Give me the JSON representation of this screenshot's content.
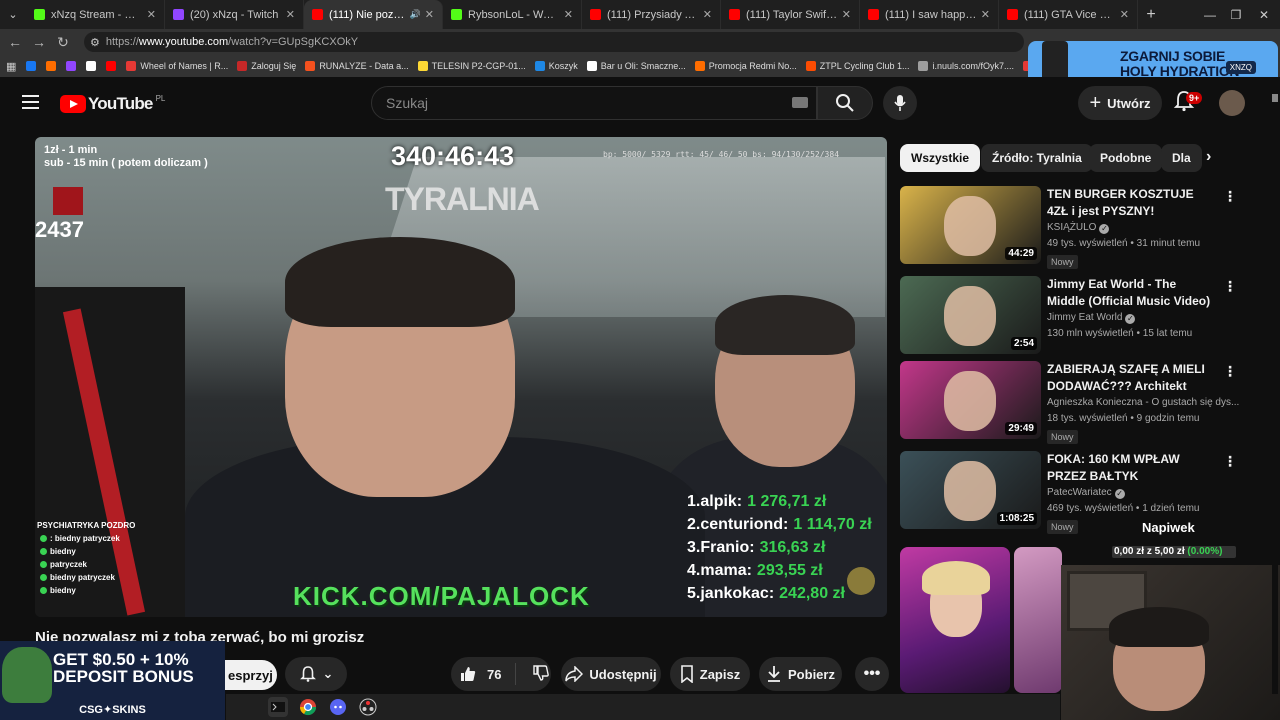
{
  "browser": {
    "tabs": [
      {
        "title": "xNzq Stream - Watch Live",
        "color": "#53fc18",
        "active": false
      },
      {
        "title": "(20) xNzq - Twitch",
        "color": "#9146ff",
        "active": false
      },
      {
        "title": "(111) Nie pozwalasz m",
        "color": "#ff0000",
        "active": true
      },
      {
        "title": "RybsonLoL - Watch clips",
        "color": "#53fc18",
        "active": false
      },
      {
        "title": "(111) Przysiady ATG 100 k",
        "color": "#ff0000",
        "active": false
      },
      {
        "title": "(111) Taylor Swift - Shake",
        "color": "#ff0000",
        "active": false
      },
      {
        "title": "(111) I saw happiness and",
        "color": "#ff0000",
        "active": false
      },
      {
        "title": "(111) GTA Vice City Radio",
        "color": "#ff0000",
        "active": false
      }
    ],
    "url_prefix": "https://",
    "url_host": "www.youtube.com",
    "url_path": "/watch?v=GUpSgKCXOkY",
    "bookmarks": [
      {
        "label": "",
        "color": "#1877f2"
      },
      {
        "label": "",
        "color": "#ff6d00"
      },
      {
        "label": "",
        "color": "#9146ff"
      },
      {
        "label": "",
        "color": "#ffffff"
      },
      {
        "label": "",
        "color": "#ff0000"
      },
      {
        "label": "Wheel of Names | R...",
        "color": "#e53935"
      },
      {
        "label": "Zaloguj Się",
        "color": "#c62828"
      },
      {
        "label": "RUNALYZE - Data a...",
        "color": "#f4511e"
      },
      {
        "label": "TELESIN P2-CGP-01...",
        "color": "#fdd835"
      },
      {
        "label": "Koszyk",
        "color": "#1e88e5"
      },
      {
        "label": "Bar u Oli: Smaczne...",
        "color": "#ffffff"
      },
      {
        "label": "Promocja Redmi No...",
        "color": "#ff6d00"
      },
      {
        "label": "ZTPL Cycling Club 1...",
        "color": "#fc4c02"
      },
      {
        "label": "i.nuuls.com/fOyk7....",
        "color": "#9e9e9e"
      },
      {
        "label": "Login",
        "color": "#e53935"
      }
    ]
  },
  "ads": {
    "top_headline_1": "ZGARNIJ SOBIE",
    "top_headline_2": "HOLY HYDRATION",
    "top_badge": "XNZQ",
    "bottom_line_1": "GET $0.50 + 10%",
    "bottom_line_2": "DEPOSIT BONUS",
    "bottom_brand": "CSG✦SKINS"
  },
  "yt": {
    "logo_text": "YouTube",
    "logo_region": "PL",
    "search_placeholder": "Szukaj",
    "create_label": "Utwórz",
    "notif_count": "9+"
  },
  "video": {
    "overlay_prices_1": "1zł - 1 min",
    "overlay_prices_2": "sub - 15 min ( potem doliczam )",
    "overlay_timer": "340:46:43",
    "overlay_stats": "bp: 5000/ 5329 rtt: 45/ 46/ 50 bs: 94/130/252/384",
    "overlay_logo": "TYRALNIA",
    "overlay_count": "2437",
    "leaderboard": [
      {
        "rank": "1.",
        "name": "alpik:",
        "amount": "1 276,71 zł"
      },
      {
        "rank": "2.",
        "name": "centuriond:",
        "amount": "1 114,70 zł"
      },
      {
        "rank": "3.",
        "name": "Franio:",
        "amount": "316,63 zł"
      },
      {
        "rank": "4.",
        "name": "mama:",
        "amount": "293,55 zł"
      },
      {
        "rank": "5.",
        "name": "jankokac:",
        "amount": "242,80 zł"
      }
    ],
    "kick_text": "KICK.COM/PAJALOCK",
    "chat_header": "PSYCHIATRYKA POZDRO",
    "chat_lines": [
      ": biedny patryczek",
      "biedny",
      "patryczek",
      "biedny patryczek",
      "biedny"
    ],
    "title": "Nie pozwalasz mi z tobą zerwać, bo mi grozisz"
  },
  "actions": {
    "join_partial": "esprzyj",
    "like_count": "76",
    "share": "Udostępnij",
    "save": "Zapisz",
    "download": "Pobierz"
  },
  "chips": [
    "Wszystkie",
    "Źródło: Tyralnia",
    "Podobne",
    "Dla"
  ],
  "related": [
    {
      "title": "TEN BURGER KOSZTUJE 4ZŁ i jest PYSZNY!",
      "channel": "KSIĄŻULO",
      "verified": true,
      "meta": "49 tys. wyświetleń • 31 minut temu",
      "duration": "44:29",
      "new": "Nowy",
      "thumb": "#d9b34a"
    },
    {
      "title": "Jimmy Eat World - The Middle (Official Music Video)",
      "channel": "Jimmy Eat World",
      "verified": true,
      "meta": "130 mln wyświetleń • 15 lat temu",
      "duration": "2:54",
      "new": "",
      "thumb": "#4c6a53"
    },
    {
      "title": "ZABIERAJĄ SZAFĘ A MIELI DODAWAĆ??? Architekt wnętr...",
      "channel": "Agnieszka Konieczna - O gustach się dys...",
      "verified": false,
      "meta": "18 tys. wyświetleń • 9 godzin temu",
      "duration": "29:49",
      "new": "Nowy",
      "thumb": "#c2378a"
    },
    {
      "title": "FOKA: 160 KM WPŁAW PRZEZ BAŁTYK",
      "channel": "PatecWariatec",
      "verified": true,
      "meta": "469 tys. wyświetleń • 1 dzień temu",
      "duration": "1:08:25",
      "new": "Nowy",
      "thumb": "#3b5058"
    }
  ],
  "tip": {
    "label": "Napiwek",
    "current": "0,00 zł",
    "separator": "z",
    "goal": "5,00 zł",
    "percent": "(0.00%)",
    "progress": 0
  },
  "colors": {
    "accent_red": "#ff0000",
    "kick_green": "#53fc18",
    "money_green": "#39d353"
  }
}
